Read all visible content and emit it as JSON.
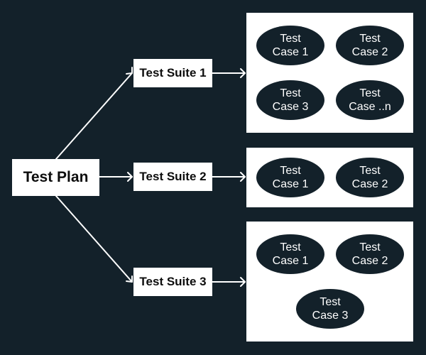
{
  "colors": {
    "background": "#13212a",
    "box_fill": "#ffffff",
    "box_text": "#0d0d0d",
    "ellipse_fill": "#13212a",
    "ellipse_text": "#ffffff",
    "connector": "#ffffff"
  },
  "plan": {
    "label": "Test Plan"
  },
  "suites": [
    {
      "label": "Test Suite 1",
      "cases": [
        {
          "line1": "Test",
          "line2": "Case 1"
        },
        {
          "line1": "Test",
          "line2": "Case 2"
        },
        {
          "line1": "Test",
          "line2": "Case 3"
        },
        {
          "line1": "Test",
          "line2": "Case ..n"
        }
      ]
    },
    {
      "label": "Test Suite 2",
      "cases": [
        {
          "line1": "Test",
          "line2": "Case 1"
        },
        {
          "line1": "Test",
          "line2": "Case 2"
        }
      ]
    },
    {
      "label": "Test Suite 3",
      "cases": [
        {
          "line1": "Test",
          "line2": "Case 1"
        },
        {
          "line1": "Test",
          "line2": "Case 2"
        },
        {
          "line1": "Test",
          "line2": "Case 3"
        }
      ]
    }
  ],
  "edges": [
    {
      "from": "Test Plan",
      "to": "Test Suite 1"
    },
    {
      "from": "Test Plan",
      "to": "Test Suite 2"
    },
    {
      "from": "Test Plan",
      "to": "Test Suite 3"
    },
    {
      "from": "Test Suite 1",
      "to": "Test Suite 1 cases"
    },
    {
      "from": "Test Suite 2",
      "to": "Test Suite 2 cases"
    },
    {
      "from": "Test Suite 3",
      "to": "Test Suite 3 cases"
    }
  ]
}
